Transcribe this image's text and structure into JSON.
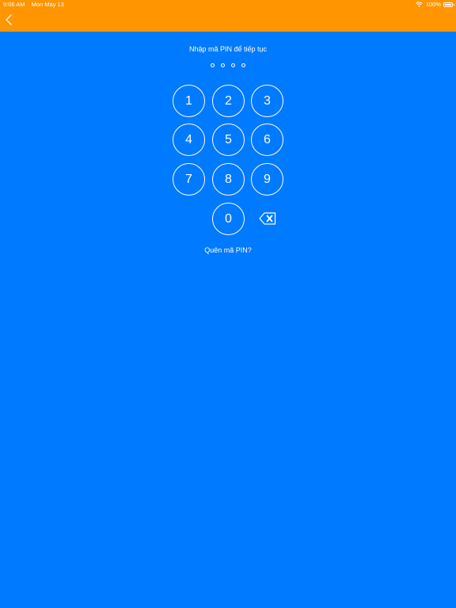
{
  "status_bar": {
    "time": "9:06 AM",
    "date": "Mon May 13",
    "battery": "100%"
  },
  "colors": {
    "header": "#ff9500",
    "background": "#007aff",
    "foreground": "#ffffff"
  },
  "header": {
    "back_icon": "chevron-left-icon"
  },
  "pin": {
    "prompt": "Nhập mã PIN để tiếp tục",
    "length": 4,
    "entered": 0
  },
  "keypad": {
    "keys": [
      "1",
      "2",
      "3",
      "4",
      "5",
      "6",
      "7",
      "8",
      "9",
      "0"
    ],
    "delete_icon": "backspace-icon"
  },
  "forgot_link": "Quên mã PIN?"
}
